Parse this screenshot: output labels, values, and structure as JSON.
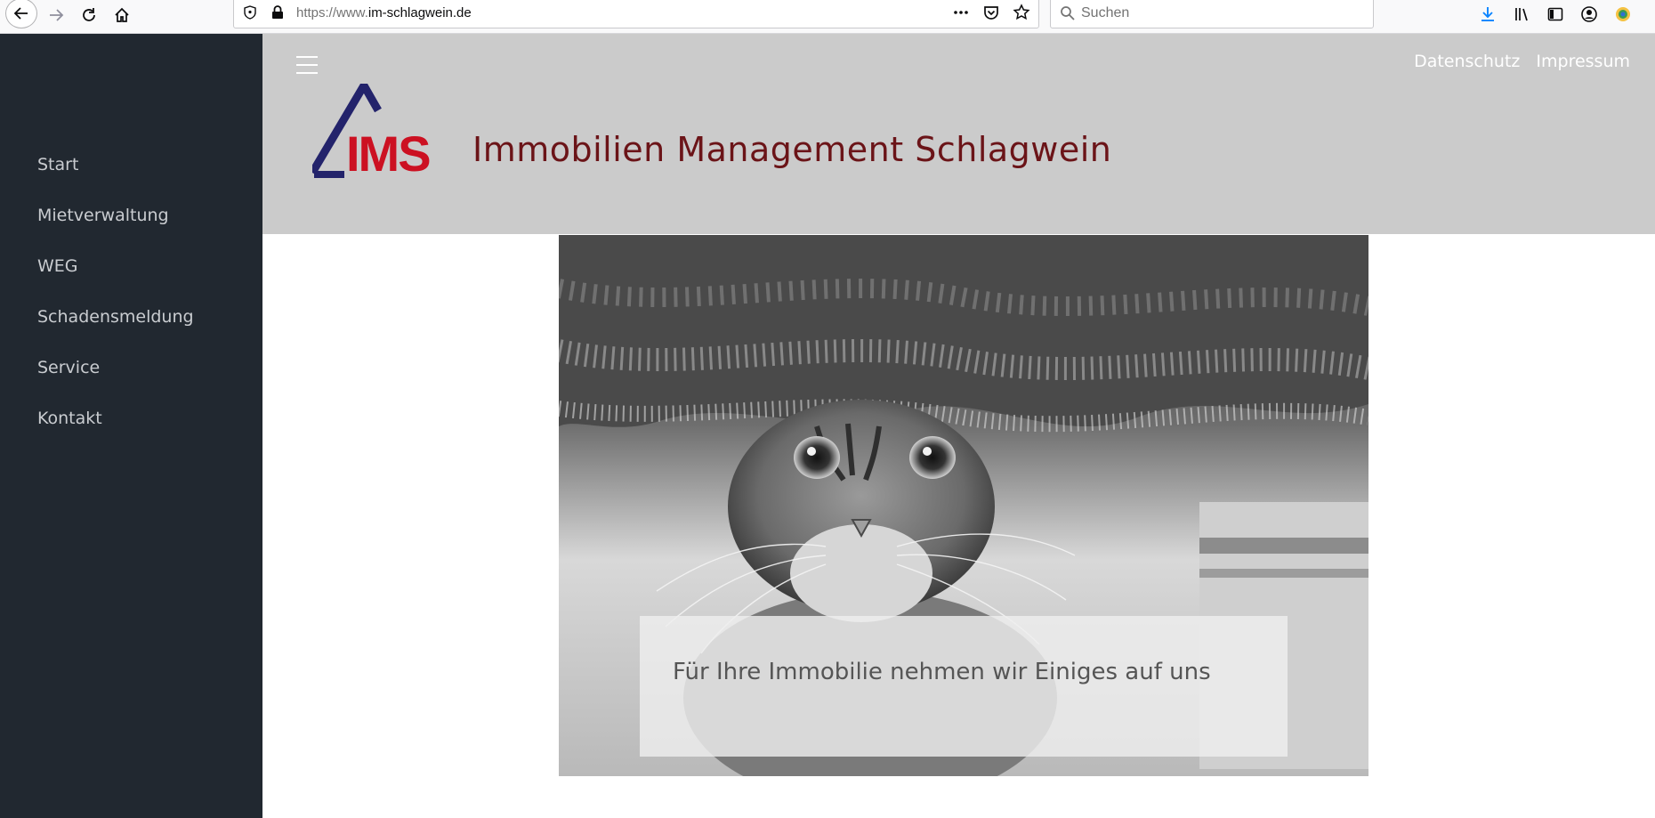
{
  "browser": {
    "url_prefix": "https://www.",
    "url_host": "im-schlagwein.de",
    "search_placeholder": "Suchen",
    "icons": {
      "back": "arrow-left-icon",
      "forward": "arrow-right-icon",
      "reload": "reload-icon",
      "home": "home-icon",
      "tracking": "shield-icon",
      "lock": "lock-icon",
      "page_actions": "ellipsis-icon",
      "pocket": "pocket-icon",
      "bookmark": "star-icon",
      "downloads": "download-icon",
      "library": "library-icon",
      "sidebar": "sidebar-icon",
      "account": "account-icon",
      "extension": "extension-icon"
    },
    "accent": "#0a84ff"
  },
  "sidebar": {
    "items": [
      {
        "label": "Start"
      },
      {
        "label": "Mietverwaltung"
      },
      {
        "label": "WEG"
      },
      {
        "label": "Schadensmeldung"
      },
      {
        "label": "Service"
      },
      {
        "label": "Kontakt"
      }
    ],
    "background": "#212830"
  },
  "header": {
    "menu_icon": "hamburger-icon",
    "links": [
      {
        "label": "Datenschutz"
      },
      {
        "label": "Impressum"
      }
    ],
    "logo_text": "IMS",
    "title": "Immobilien Management Schlagwein",
    "background": "#cbcbcb",
    "title_color": "#6b1418"
  },
  "hero": {
    "caption": "Für Ihre Immobilie nehmen wir Einiges auf uns",
    "image": "cat-under-carpet-photo"
  },
  "colors": {
    "logo_blue": "#23236b",
    "logo_red": "#cc1122"
  }
}
